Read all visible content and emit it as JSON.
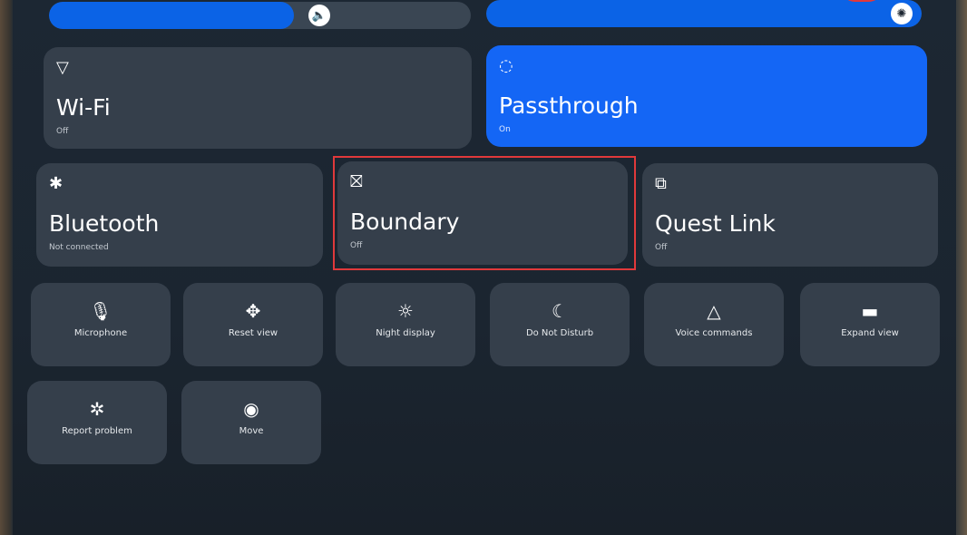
{
  "sliders": {
    "volume": {
      "level": 0.58,
      "icon": "volume-icon"
    },
    "brightness": {
      "level": 1.0,
      "icon": "brightness-icon"
    }
  },
  "large_tiles": [
    {
      "title": "Wi-Fi",
      "status": "Off",
      "icon": "wifi-icon",
      "active": false
    },
    {
      "title": "Passthrough",
      "status": "On",
      "icon": "passthrough-icon",
      "active": true
    },
    {
      "title": "Bluetooth",
      "status": "Not connected",
      "icon": "bluetooth-icon",
      "active": false
    },
    {
      "title": "Boundary",
      "status": "Off",
      "icon": "boundary-icon",
      "active": false
    },
    {
      "title": "Quest Link",
      "status": "Off",
      "icon": "quest-link-icon",
      "active": false
    }
  ],
  "small_tiles": [
    {
      "label": "Microphone",
      "icon": "microphone-icon"
    },
    {
      "label": "Reset view",
      "icon": "move-arrows-icon"
    },
    {
      "label": "Night display",
      "icon": "sun-icon"
    },
    {
      "label": "Do Not Disturb",
      "icon": "moon-icon"
    },
    {
      "label": "Voice commands",
      "icon": "voice-commands-icon"
    },
    {
      "label": "Expand view",
      "icon": "expand-view-icon"
    },
    {
      "label": "Report problem",
      "icon": "bug-icon"
    },
    {
      "label": "Move",
      "icon": "move-icon"
    }
  ],
  "colors": {
    "accent": "#1466f5",
    "tile": "#353f4b",
    "highlight": "#e0393b"
  }
}
